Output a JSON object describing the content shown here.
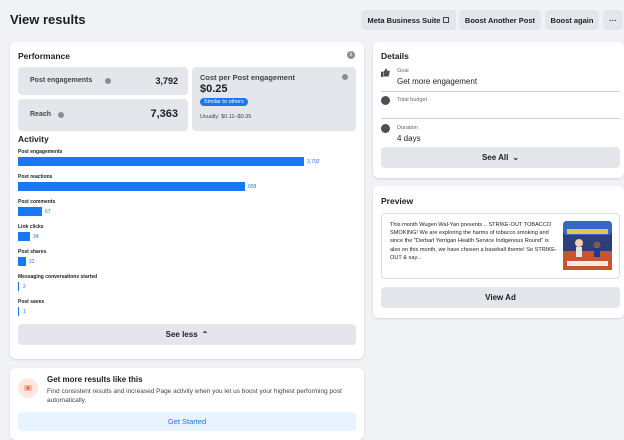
{
  "header": {
    "title": "View results",
    "buttons": {
      "meta_suite": "Meta Business Suite",
      "boost_another": "Boost Another Post",
      "boost_again": "Boost again",
      "more": "···"
    }
  },
  "performance": {
    "title": "Performance",
    "metrics": {
      "engagements_label": "Post engagements",
      "engagements_value": "3,792",
      "reach_label": "Reach",
      "reach_value": "7,363",
      "cost_label": "Cost per Post engagement",
      "cost_value": "$0.25",
      "cost_badge": "Similar to others",
      "cost_usually": "Usually: $0.11–$0.35"
    },
    "activity_title": "Activity",
    "activity": [
      {
        "label": "Post engagements",
        "value": "3,792",
        "fraction": 1.0
      },
      {
        "label": "Post reactions",
        "value": "658",
        "fraction": 0.793
      },
      {
        "label": "Post comments",
        "value": "67",
        "fraction": 0.085
      },
      {
        "label": "Link clicks",
        "value": "34",
        "fraction": 0.043
      },
      {
        "label": "Post shares",
        "value": "22",
        "fraction": 0.028
      },
      {
        "label": "Messaging conversations started",
        "value": "2",
        "fraction": 0.004
      },
      {
        "label": "Post saves",
        "value": "1",
        "fraction": 0.003
      }
    ],
    "see_less": "See less",
    "see_less_chevron": "⌃"
  },
  "boost_promo": {
    "title": "Get more results like this",
    "description": "Find consistent results and increased Page activity when you let us boost your highest performing post automatically.",
    "button": "Get Started"
  },
  "details": {
    "title": "Details",
    "goal_label": "Goal",
    "goal_value": "Get more engagement",
    "budget_label": "Total budget",
    "duration_label": "Duration",
    "duration_value": "4 days",
    "see_all": "See All",
    "see_all_chevron": "⌄"
  },
  "preview": {
    "title": "Preview",
    "text": "This month Wugen Wal-Yan presents... STRIKE-OUT TOBACCO SMOKING! We are exploring the harms of tobacco smoking and since the \"Derbarl Yerrigan Health Service Indigenous Round\" is also on this month, we have chosen a baseball theme! So STRIKE-OUT & say...",
    "view_ad": "View Ad"
  },
  "colors": {
    "accent": "#1877f2",
    "background": "#f0f2f5",
    "button_gray": "#e4e6eb"
  }
}
